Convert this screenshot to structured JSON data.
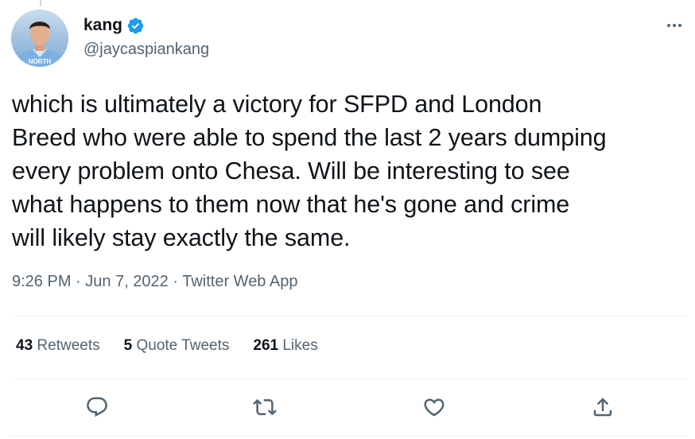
{
  "author": {
    "display_name": "kang",
    "handle": "@jaycaspiankang",
    "verified": true,
    "avatar_jersey_text": "NORTH"
  },
  "tweet": {
    "text": "which is ultimately a victory for SFPD and London\nBreed who were able to spend the last 2 years dumping\nevery problem onto Chesa. Will be interesting to see\nwhat happens to them now that he's gone and crime\nwill likely stay exactly the same.",
    "time": "9:26 PM",
    "separator": " · ",
    "date": "Jun 7, 2022",
    "source": "Twitter Web App"
  },
  "stats": {
    "retweets_count": "43",
    "retweets_label": "Retweets",
    "quotes_count": "5",
    "quotes_label": "Quote Tweets",
    "likes_count": "261",
    "likes_label": "Likes"
  },
  "icons": {
    "reply": "reply-icon",
    "retweet": "retweet-icon",
    "like": "heart-icon",
    "share": "share-icon",
    "more": "more-icon",
    "verified": "verified-badge-icon"
  },
  "colors": {
    "text": "#0f1419",
    "secondary": "#536471",
    "verified": "#1d9bf0",
    "divider": "#eff3f4"
  }
}
